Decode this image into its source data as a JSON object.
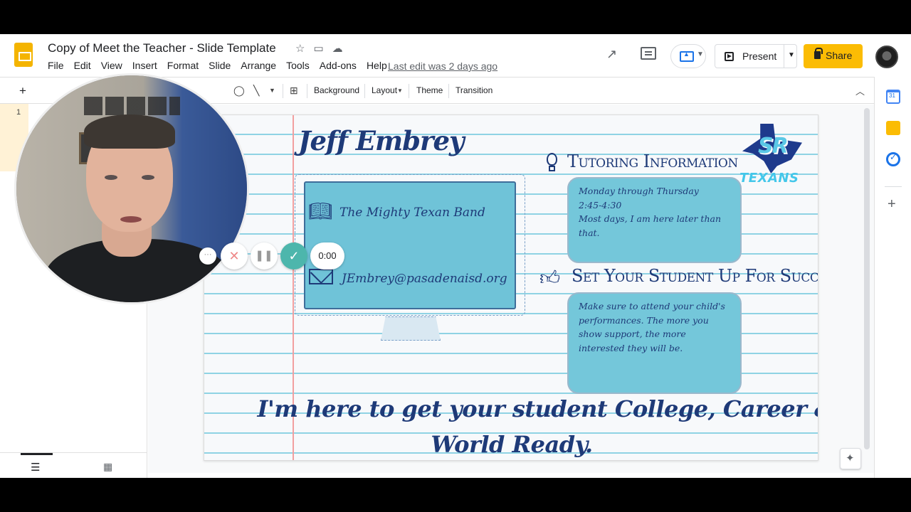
{
  "app": {
    "doc_title": "Copy of Meet the Teacher - Slide Template",
    "menu": [
      "File",
      "Edit",
      "View",
      "Insert",
      "Format",
      "Slide",
      "Arrange",
      "Tools",
      "Add-ons",
      "Help"
    ],
    "last_edit": "Last edit was 2 days ago",
    "present_label": "Present",
    "share_label": "Share",
    "accent_yellow": "#fbbc04"
  },
  "toolbar": {
    "background_label": "Background",
    "layout_label": "Layout",
    "theme_label": "Theme",
    "transition_label": "Transition"
  },
  "filmstrip": {
    "slide_number": "1"
  },
  "slide": {
    "name": "Jeff Embrey",
    "band": "The Mighty Texan Band",
    "email": "JEmbrey@pasadenaisd.org",
    "tutoring_heading": "Tutoring Information",
    "tutoring_lines": [
      "Monday through Thursday",
      "2:45-4:30",
      "Most days, I am here later than that."
    ],
    "success_heading": "Set Your Student Up For Success",
    "success_text": "Make sure to attend your child's performances.  The more you show support, the more interested they will be.",
    "logo_initials": "SR",
    "logo_word": "TEXANS",
    "slogan_line1": "I'm here to get your student College, Career &",
    "slogan_line2": "World Ready.",
    "text_color": "#1e3a78",
    "box_color": "#74c7da"
  },
  "recorder": {
    "timer": "0:00",
    "more_label": "···"
  }
}
